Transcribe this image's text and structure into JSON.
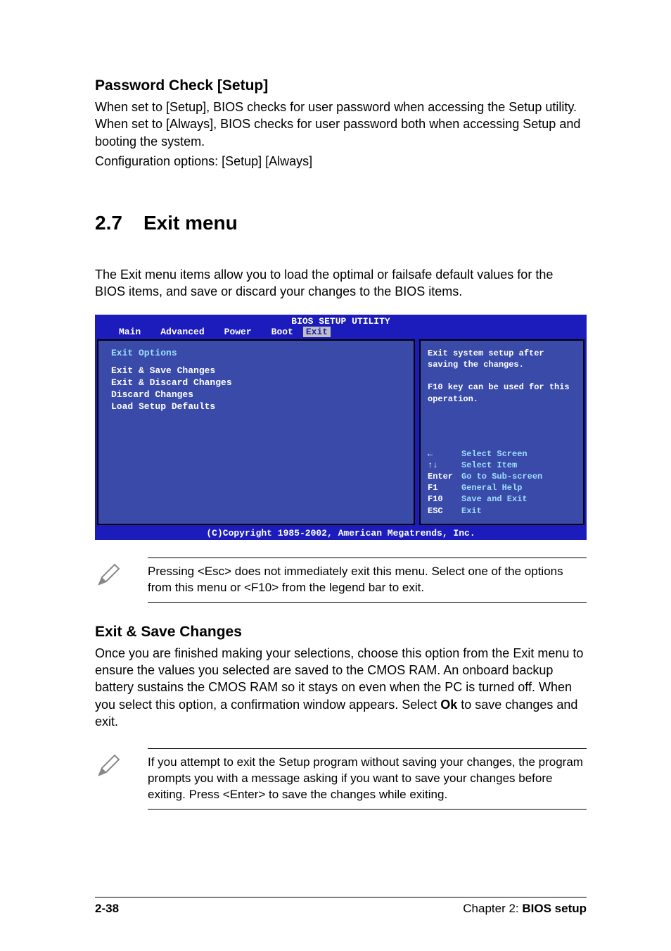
{
  "section1": {
    "title": "Password Check [Setup]",
    "para1": "When set to [Setup], BIOS checks for user password when accessing the Setup utility. When set to [Always], BIOS checks for user password both when accessing Setup and booting the system.",
    "para2": "Configuration options: [Setup] [Always]"
  },
  "chapter": {
    "num": "2.7",
    "title": "Exit menu"
  },
  "intro": "The Exit menu items allow you to load the optimal or failsafe default values for the BIOS items, and save or discard your changes to the BIOS items.",
  "bios": {
    "title": "BIOS SETUP UTILITY",
    "tabs": [
      "Main",
      "Advanced",
      "Power",
      "Boot",
      "Exit"
    ],
    "selected_tab": "Exit",
    "left": {
      "heading": "Exit Options",
      "items": [
        "Exit & Save Changes",
        "Exit & Discard Changes",
        "Discard Changes",
        "",
        "Load Setup Defaults"
      ]
    },
    "right": {
      "help_top": "Exit system setup after saving the changes.\n\nF10 key can be used for this operation.",
      "keys": [
        {
          "k": "←",
          "v": "Select Screen"
        },
        {
          "k": "↑↓",
          "v": "Select Item"
        },
        {
          "k": "Enter",
          "v": "Go to Sub-screen"
        },
        {
          "k": "F1",
          "v": "General Help"
        },
        {
          "k": "F10",
          "v": "Save and Exit"
        },
        {
          "k": "ESC",
          "v": "Exit"
        }
      ]
    },
    "footer": "(C)Copyright 1985-2002, American Megatrends, Inc."
  },
  "note1": "Pressing <Esc> does not immediately exit this menu. Select one of the options from this menu or <F10> from the legend bar to exit.",
  "section2": {
    "title": "Exit & Save Changes",
    "para_pre": "Once you are finished making your selections, choose this option from the Exit menu to ensure the values you selected are saved to the CMOS RAM. An onboard backup battery sustains the CMOS RAM so it stays on even when the PC is turned off. When you select this option, a confirmation window appears. Select ",
    "ok": "Ok",
    "para_post": " to save changes and exit."
  },
  "note2": " If you attempt to exit the Setup program without saving your changes, the program prompts you with a message asking if you want to save your changes before exiting. Press <Enter>  to save the  changes while exiting.",
  "footer": {
    "left": "2-38",
    "right_pre": "Chapter 2: ",
    "right_bold": "BIOS setup"
  }
}
